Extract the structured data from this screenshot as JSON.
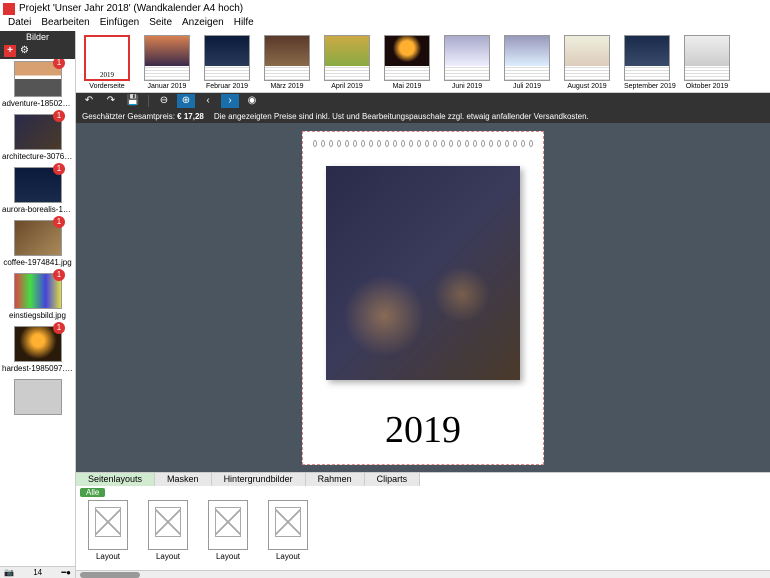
{
  "window": {
    "title": "Projekt 'Unser Jahr 2018' (Wandkalender A4 hoch)"
  },
  "menu": [
    "Datei",
    "Bearbeiten",
    "Einfügen",
    "Seite",
    "Anzeigen",
    "Hilfe"
  ],
  "sidebar": {
    "title": "Bilder",
    "items": [
      {
        "label": "adventure-1850239...",
        "badge": "1",
        "cls": "t-mtn"
      },
      {
        "label": "architecture-307668...",
        "badge": "1",
        "cls": "t-arch"
      },
      {
        "label": "aurora-borealis-183...",
        "badge": "1",
        "cls": "t-aurora"
      },
      {
        "label": "coffee-1974841.jpg",
        "badge": "1",
        "cls": "t-coffee"
      },
      {
        "label": "einstiegsbild.jpg",
        "badge": "1",
        "cls": "t-kids"
      },
      {
        "label": "hardest-1985097.jpg",
        "badge": "1",
        "cls": "t-candle"
      },
      {
        "label": "",
        "badge": "",
        "cls": "t-gray"
      }
    ],
    "footer_icon": "📷",
    "footer_count": "14"
  },
  "months": {
    "cover_year": "2019",
    "items": [
      {
        "label": "Vorderseite",
        "selected": true,
        "cls": "cover-2019"
      },
      {
        "label": "Januar 2019",
        "cls": "mi-sunset"
      },
      {
        "label": "Februar 2019",
        "cls": "mi-blue"
      },
      {
        "label": "März 2019",
        "cls": "mi-city"
      },
      {
        "label": "April 2019",
        "cls": "mi-flower"
      },
      {
        "label": "Mai 2019",
        "cls": "mi-moon"
      },
      {
        "label": "Juni 2019",
        "cls": "mi-snow1"
      },
      {
        "label": "Juli 2019",
        "cls": "mi-snow2"
      },
      {
        "label": "August 2019",
        "cls": "mi-beach"
      },
      {
        "label": "September 2019",
        "cls": "mi-night"
      },
      {
        "label": "Oktober 2019",
        "cls": "mi-white"
      }
    ]
  },
  "toolbar": {
    "undo": "↶",
    "redo": "↷",
    "save": "💾",
    "zoom_out": "⊖",
    "zoom_in": "⊕",
    "prev": "‹",
    "next": "›",
    "preview": "◉"
  },
  "price": {
    "label": "Geschätzter Gesamtpreis:",
    "value": "€ 17,28",
    "note": "Die angezeigten Preise sind inkl. Ust und Bearbeitungspauschale zzgl. etwaig anfallender Versandkosten."
  },
  "page": {
    "year": "2019"
  },
  "tabs": [
    "Seitenlayouts",
    "Masken",
    "Hintergrundbilder",
    "Rahmen",
    "Cliparts"
  ],
  "filter": {
    "all": "Alle"
  },
  "layouts": [
    {
      "label": "Layout"
    },
    {
      "label": "Layout"
    },
    {
      "label": "Layout"
    },
    {
      "label": "Layout"
    }
  ]
}
